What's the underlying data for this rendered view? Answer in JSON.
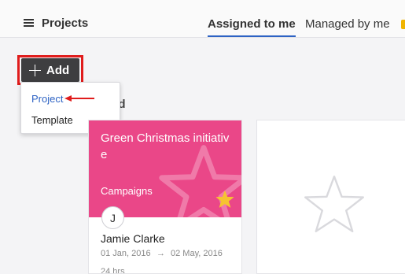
{
  "header": {
    "menu_icon": "hamburger-menu-icon",
    "title": "Projects",
    "tabs": [
      {
        "label": "Assigned to me",
        "active": true
      },
      {
        "label": "Managed by me",
        "active": false
      }
    ],
    "accent_color": "#2e63c4"
  },
  "toolbar": {
    "add_label": "Add",
    "add_icon": "plus-icon",
    "highlight_color": "#e01c1c"
  },
  "dropdown": {
    "items": [
      {
        "label": "Project",
        "highlighted": true
      },
      {
        "label": "Template",
        "highlighted": false
      }
    ],
    "annotation": "red-arrow-icon"
  },
  "section": {
    "title": "Assigned"
  },
  "projects": [
    {
      "title": "Green Christmas initiative",
      "category": "Campaigns",
      "color": "#ea4788",
      "favorite": true,
      "owner_initial": "J",
      "owner_name": "Jamie Clarke",
      "start_date": "01 Jan, 2016",
      "date_separator": "→",
      "end_date": "02 May, 2016",
      "hours": "24 hrs"
    }
  ],
  "placeholder": {
    "icon": "star-outline-icon"
  }
}
